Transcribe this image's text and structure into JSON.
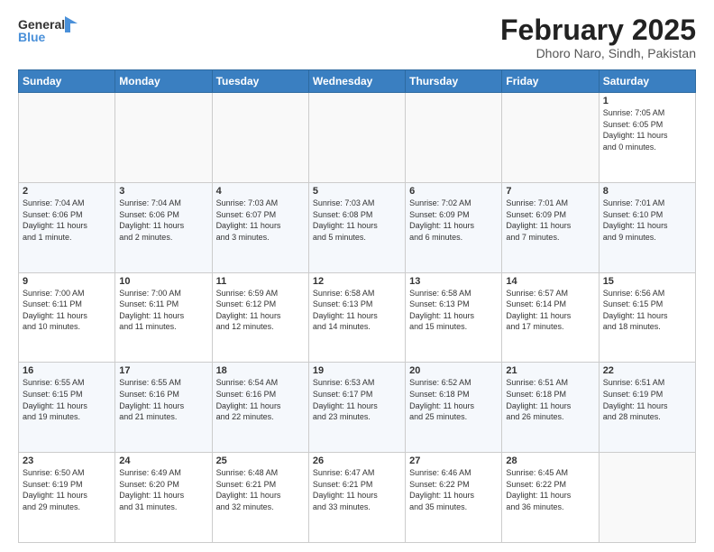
{
  "logo": {
    "line1": "General",
    "line2": "Blue"
  },
  "header": {
    "title": "February 2025",
    "subtitle": "Dhoro Naro, Sindh, Pakistan"
  },
  "days_of_week": [
    "Sunday",
    "Monday",
    "Tuesday",
    "Wednesday",
    "Thursday",
    "Friday",
    "Saturday"
  ],
  "weeks": [
    [
      {
        "day": "",
        "info": ""
      },
      {
        "day": "",
        "info": ""
      },
      {
        "day": "",
        "info": ""
      },
      {
        "day": "",
        "info": ""
      },
      {
        "day": "",
        "info": ""
      },
      {
        "day": "",
        "info": ""
      },
      {
        "day": "1",
        "info": "Sunrise: 7:05 AM\nSunset: 6:05 PM\nDaylight: 11 hours\nand 0 minutes."
      }
    ],
    [
      {
        "day": "2",
        "info": "Sunrise: 7:04 AM\nSunset: 6:06 PM\nDaylight: 11 hours\nand 1 minute."
      },
      {
        "day": "3",
        "info": "Sunrise: 7:04 AM\nSunset: 6:06 PM\nDaylight: 11 hours\nand 2 minutes."
      },
      {
        "day": "4",
        "info": "Sunrise: 7:03 AM\nSunset: 6:07 PM\nDaylight: 11 hours\nand 3 minutes."
      },
      {
        "day": "5",
        "info": "Sunrise: 7:03 AM\nSunset: 6:08 PM\nDaylight: 11 hours\nand 5 minutes."
      },
      {
        "day": "6",
        "info": "Sunrise: 7:02 AM\nSunset: 6:09 PM\nDaylight: 11 hours\nand 6 minutes."
      },
      {
        "day": "7",
        "info": "Sunrise: 7:01 AM\nSunset: 6:09 PM\nDaylight: 11 hours\nand 7 minutes."
      },
      {
        "day": "8",
        "info": "Sunrise: 7:01 AM\nSunset: 6:10 PM\nDaylight: 11 hours\nand 9 minutes."
      }
    ],
    [
      {
        "day": "9",
        "info": "Sunrise: 7:00 AM\nSunset: 6:11 PM\nDaylight: 11 hours\nand 10 minutes."
      },
      {
        "day": "10",
        "info": "Sunrise: 7:00 AM\nSunset: 6:11 PM\nDaylight: 11 hours\nand 11 minutes."
      },
      {
        "day": "11",
        "info": "Sunrise: 6:59 AM\nSunset: 6:12 PM\nDaylight: 11 hours\nand 12 minutes."
      },
      {
        "day": "12",
        "info": "Sunrise: 6:58 AM\nSunset: 6:13 PM\nDaylight: 11 hours\nand 14 minutes."
      },
      {
        "day": "13",
        "info": "Sunrise: 6:58 AM\nSunset: 6:13 PM\nDaylight: 11 hours\nand 15 minutes."
      },
      {
        "day": "14",
        "info": "Sunrise: 6:57 AM\nSunset: 6:14 PM\nDaylight: 11 hours\nand 17 minutes."
      },
      {
        "day": "15",
        "info": "Sunrise: 6:56 AM\nSunset: 6:15 PM\nDaylight: 11 hours\nand 18 minutes."
      }
    ],
    [
      {
        "day": "16",
        "info": "Sunrise: 6:55 AM\nSunset: 6:15 PM\nDaylight: 11 hours\nand 19 minutes."
      },
      {
        "day": "17",
        "info": "Sunrise: 6:55 AM\nSunset: 6:16 PM\nDaylight: 11 hours\nand 21 minutes."
      },
      {
        "day": "18",
        "info": "Sunrise: 6:54 AM\nSunset: 6:16 PM\nDaylight: 11 hours\nand 22 minutes."
      },
      {
        "day": "19",
        "info": "Sunrise: 6:53 AM\nSunset: 6:17 PM\nDaylight: 11 hours\nand 23 minutes."
      },
      {
        "day": "20",
        "info": "Sunrise: 6:52 AM\nSunset: 6:18 PM\nDaylight: 11 hours\nand 25 minutes."
      },
      {
        "day": "21",
        "info": "Sunrise: 6:51 AM\nSunset: 6:18 PM\nDaylight: 11 hours\nand 26 minutes."
      },
      {
        "day": "22",
        "info": "Sunrise: 6:51 AM\nSunset: 6:19 PM\nDaylight: 11 hours\nand 28 minutes."
      }
    ],
    [
      {
        "day": "23",
        "info": "Sunrise: 6:50 AM\nSunset: 6:19 PM\nDaylight: 11 hours\nand 29 minutes."
      },
      {
        "day": "24",
        "info": "Sunrise: 6:49 AM\nSunset: 6:20 PM\nDaylight: 11 hours\nand 31 minutes."
      },
      {
        "day": "25",
        "info": "Sunrise: 6:48 AM\nSunset: 6:21 PM\nDaylight: 11 hours\nand 32 minutes."
      },
      {
        "day": "26",
        "info": "Sunrise: 6:47 AM\nSunset: 6:21 PM\nDaylight: 11 hours\nand 33 minutes."
      },
      {
        "day": "27",
        "info": "Sunrise: 6:46 AM\nSunset: 6:22 PM\nDaylight: 11 hours\nand 35 minutes."
      },
      {
        "day": "28",
        "info": "Sunrise: 6:45 AM\nSunset: 6:22 PM\nDaylight: 11 hours\nand 36 minutes."
      },
      {
        "day": "",
        "info": ""
      }
    ]
  ]
}
